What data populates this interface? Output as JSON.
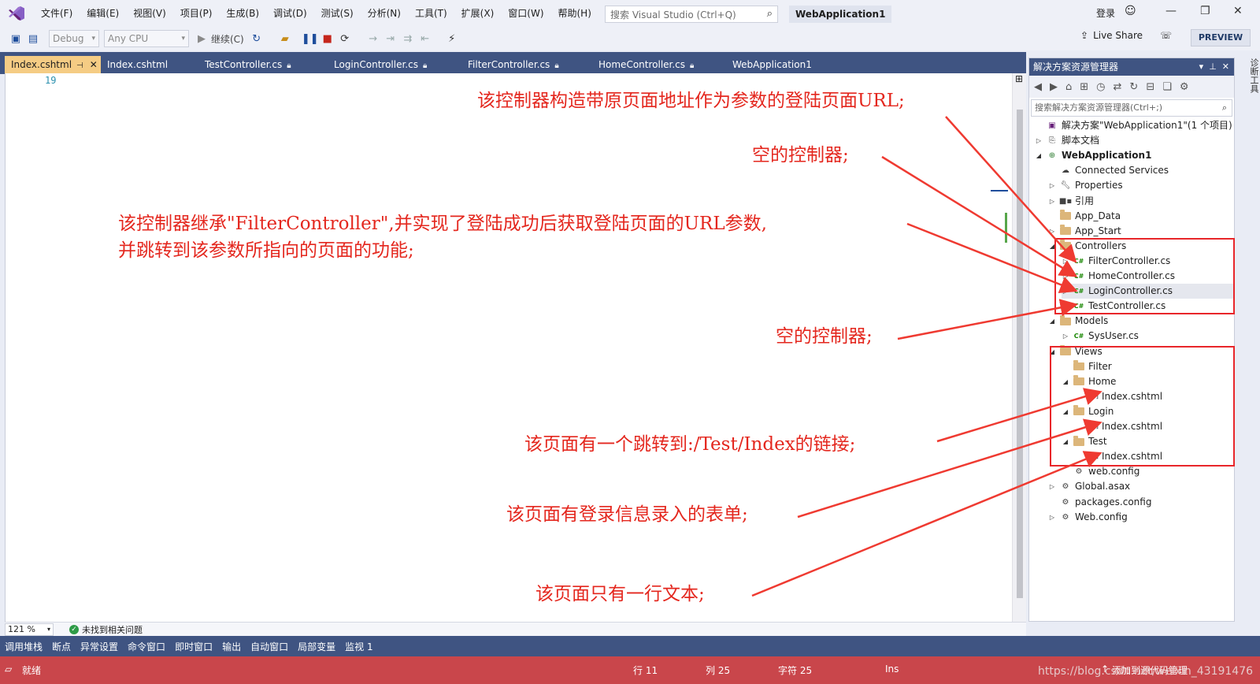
{
  "titlebar": {
    "menu": [
      "文件(F)",
      "编辑(E)",
      "视图(V)",
      "项目(P)",
      "生成(B)",
      "调试(D)",
      "测试(S)",
      "分析(N)",
      "工具(T)",
      "扩展(X)",
      "窗口(W)",
      "帮助(H)"
    ],
    "search_placeholder": "搜索 Visual Studio (Ctrl+Q)",
    "solution_name": "WebApplication1",
    "login": "登录"
  },
  "toolbar": {
    "config": "Debug",
    "platform": "Any CPU",
    "continue": "继续(C)",
    "live_share": "Live Share",
    "preview": "PREVIEW"
  },
  "tabs": [
    {
      "label": "Index.cshtml",
      "active": true
    },
    {
      "label": "Index.cshtml"
    },
    {
      "label": "TestController.cs"
    },
    {
      "label": "LoginController.cs"
    },
    {
      "label": "FilterController.cs"
    },
    {
      "label": "HomeController.cs"
    },
    {
      "label": "WebApplication1"
    }
  ],
  "editor": {
    "line_number": "19",
    "zoom": "121 %",
    "issues": "未找到相关问题"
  },
  "debug_tabs": [
    "调用堆栈",
    "断点",
    "异常设置",
    "命令窗口",
    "即时窗口",
    "输出",
    "自动窗口",
    "局部变量",
    "监视 1"
  ],
  "statusbar": {
    "ready": "就绪",
    "line": "行 11",
    "col": "列 25",
    "char": "字符 25",
    "ins": "Ins",
    "source_control": "添加到源代码管理",
    "watermark": "https://blog.csdn.net/weixin_43191476"
  },
  "solution_explorer": {
    "title": "解决方案资源管理器",
    "search_placeholder": "搜索解决方案资源管理器(Ctrl+;)",
    "right_strip": "诊断工具",
    "tree": [
      {
        "label": "解决方案\"WebApplication1\"(1 个项目)",
        "level": 0,
        "icon": "solution-icon",
        "twisty": ""
      },
      {
        "label": "脚本文档",
        "level": 0,
        "icon": "script-docs-icon",
        "twisty": "▷"
      },
      {
        "label": "WebApplication1",
        "level": 0,
        "icon": "web-project-icon",
        "twisty": "◢",
        "bold": true
      },
      {
        "label": "Connected Services",
        "level": 1,
        "icon": "connected-services-icon",
        "twisty": ""
      },
      {
        "label": "Properties",
        "level": 1,
        "icon": "wrench-icon",
        "twisty": "▷"
      },
      {
        "label": "引用",
        "level": 1,
        "icon": "references-icon",
        "twisty": "▷"
      },
      {
        "label": "App_Data",
        "level": 1,
        "icon": "folder-icon",
        "twisty": ""
      },
      {
        "label": "App_Start",
        "level": 1,
        "icon": "folder-icon",
        "twisty": "▷"
      },
      {
        "label": "Controllers",
        "level": 1,
        "icon": "folder-icon",
        "twisty": "◢"
      },
      {
        "label": "FilterController.cs",
        "level": 2,
        "icon": "csharp-file-icon",
        "twisty": "▷"
      },
      {
        "label": "HomeController.cs",
        "level": 2,
        "icon": "csharp-file-icon",
        "twisty": "▷"
      },
      {
        "label": "LoginController.cs",
        "level": 2,
        "icon": "csharp-file-icon",
        "twisty": "▷",
        "selected": true
      },
      {
        "label": "TestController.cs",
        "level": 2,
        "icon": "csharp-file-icon",
        "twisty": "▷"
      },
      {
        "label": "Models",
        "level": 1,
        "icon": "folder-icon",
        "twisty": "◢"
      },
      {
        "label": "SysUser.cs",
        "level": 2,
        "icon": "csharp-file-icon",
        "twisty": "▷"
      },
      {
        "label": "Views",
        "level": 1,
        "icon": "folder-icon",
        "twisty": "◢"
      },
      {
        "label": "Filter",
        "level": 2,
        "icon": "folder-icon",
        "twisty": ""
      },
      {
        "label": "Home",
        "level": 2,
        "icon": "folder-icon",
        "twisty": "◢"
      },
      {
        "label": "Index.cshtml",
        "level": 3,
        "icon": "razor-file-icon",
        "twisty": ""
      },
      {
        "label": "Login",
        "level": 2,
        "icon": "folder-icon",
        "twisty": "◢"
      },
      {
        "label": "Index.cshtml",
        "level": 3,
        "icon": "razor-file-icon",
        "twisty": ""
      },
      {
        "label": "Test",
        "level": 2,
        "icon": "folder-icon",
        "twisty": "◢"
      },
      {
        "label": "Index.cshtml",
        "level": 3,
        "icon": "razor-file-icon",
        "twisty": ""
      },
      {
        "label": "web.config",
        "level": 2,
        "icon": "config-file-icon",
        "twisty": ""
      },
      {
        "label": "Global.asax",
        "level": 1,
        "icon": "config-file-icon",
        "twisty": "▷"
      },
      {
        "label": "packages.config",
        "level": 1,
        "icon": "config-file-icon",
        "twisty": ""
      },
      {
        "label": "Web.config",
        "level": 1,
        "icon": "config-file-icon",
        "twisty": "▷"
      }
    ]
  },
  "annotations": {
    "a1": "该控制器构造带原页面地址作为参数的登陆页面URL;",
    "a2": "空的控制器;",
    "a3_line1": "该控制器继承\"FilterController\",并实现了登陆成功后获取登陆页面的URL参数,",
    "a3_line2": "并跳转到该参数所指向的页面的功能;",
    "a4": "空的控制器;",
    "a5": "该页面有一个跳转到:/Test/Index的链接;",
    "a6": "该页面有登录信息录入的表单;",
    "a7": "该页面只有一行文本;",
    "color": "#e4271e"
  }
}
